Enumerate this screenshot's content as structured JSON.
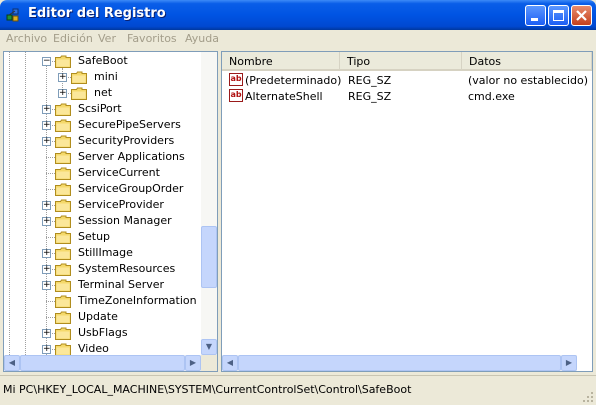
{
  "window": {
    "title": "Editor del Registro"
  },
  "menu": [
    "Archivo",
    "Edición",
    "Ver",
    "Favoritos",
    "Ayuda"
  ],
  "tree": {
    "items": [
      {
        "label": "SafeBoot",
        "level": 1,
        "expander": "−"
      },
      {
        "label": "mini",
        "level": 2,
        "expander": "+"
      },
      {
        "label": "net",
        "level": 2,
        "expander": "+"
      },
      {
        "label": "ScsiPort",
        "level": 1,
        "expander": "+"
      },
      {
        "label": "SecurePipeServers",
        "level": 1,
        "expander": "+"
      },
      {
        "label": "SecurityProviders",
        "level": 1,
        "expander": "+"
      },
      {
        "label": "Server Applications",
        "level": 1,
        "expander": ""
      },
      {
        "label": "ServiceCurrent",
        "level": 1,
        "expander": ""
      },
      {
        "label": "ServiceGroupOrder",
        "level": 1,
        "expander": ""
      },
      {
        "label": "ServiceProvider",
        "level": 1,
        "expander": "+"
      },
      {
        "label": "Session Manager",
        "level": 1,
        "expander": "+"
      },
      {
        "label": "Setup",
        "level": 1,
        "expander": ""
      },
      {
        "label": "StillImage",
        "level": 1,
        "expander": "+"
      },
      {
        "label": "SystemResources",
        "level": 1,
        "expander": "+"
      },
      {
        "label": "Terminal Server",
        "level": 1,
        "expander": "+"
      },
      {
        "label": "TimeZoneInformation",
        "level": 1,
        "expander": ""
      },
      {
        "label": "Update",
        "level": 1,
        "expander": ""
      },
      {
        "label": "UsbFlags",
        "level": 1,
        "expander": "+"
      },
      {
        "label": "Video",
        "level": 1,
        "expander": "+"
      }
    ]
  },
  "list": {
    "columns": [
      "Nombre",
      "Tipo",
      "Datos"
    ],
    "rows": [
      {
        "name": "(Predeterminado)",
        "type": "REG_SZ",
        "data": "(valor no establecido)",
        "icon": "ab-string-icon"
      },
      {
        "name": "AlternateShell",
        "type": "REG_SZ",
        "data": "cmd.exe",
        "icon": "ab-string-icon"
      }
    ]
  },
  "status": {
    "path": "Mi PC\\HKEY_LOCAL_MACHINE\\SYSTEM\\CurrentControlSet\\Control\\SafeBoot"
  },
  "colors": {
    "titlebar": "#0054e3",
    "close_button": "#c4401c",
    "folder": "#f5d96b",
    "icon_red": "#b01010"
  }
}
